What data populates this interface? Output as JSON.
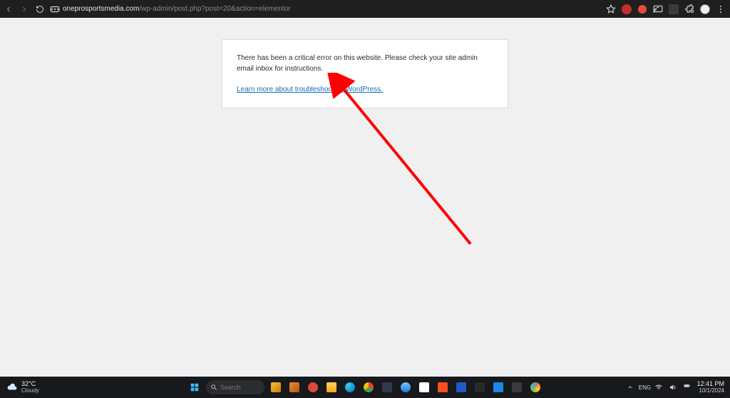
{
  "browser": {
    "url_host": "oneprosportsmedia.com",
    "url_path": "/wp-admin/post.php?post=20&action=elementor"
  },
  "error": {
    "message": "There has been a critical error on this website. Please check your site admin email inbox for instructions.",
    "link_text": "Learn more about troubleshooting WordPress."
  },
  "weather": {
    "temp": "32°C",
    "desc": "Cloudy"
  },
  "taskbar": {
    "search_placeholder": "Search"
  },
  "clock": {
    "time": "12:41 PM",
    "date": "10/1/2024"
  },
  "annotation": {
    "arrow_color": "#ff0000"
  }
}
